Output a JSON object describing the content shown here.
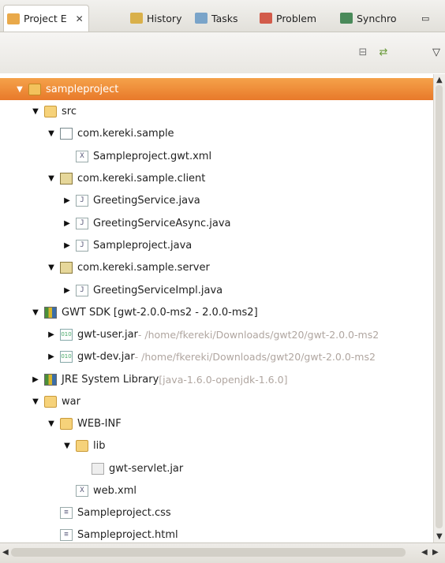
{
  "tabs": [
    {
      "label": "Project E",
      "close": "✕",
      "icon_color": "#e9a94a"
    },
    {
      "label": "History",
      "icon_color": "#d9b04a"
    },
    {
      "label": "Tasks",
      "icon_color": "#7aa4c9"
    },
    {
      "label": "Problem",
      "icon_color": "#d25b4a"
    },
    {
      "label": "Synchro",
      "icon_color": "#4a8a5a"
    }
  ],
  "tree": [
    {
      "label": "sampleproject",
      "extra": "",
      "icon": "project",
      "twisty": "open",
      "selected": true
    },
    {
      "label": "src",
      "extra": "",
      "icon": "folder",
      "twisty": "open"
    },
    {
      "label": "com.kereki.sample",
      "extra": "",
      "icon": "pkgempty",
      "twisty": "open"
    },
    {
      "label": "Sampleproject.gwt.xml",
      "extra": "",
      "icon": "file",
      "glyph": "X",
      "twisty": "none"
    },
    {
      "label": "com.kereki.sample.client",
      "extra": "",
      "icon": "pkg",
      "twisty": "open"
    },
    {
      "label": "GreetingService.java",
      "extra": "",
      "icon": "file",
      "glyph": "J",
      "twisty": "closed"
    },
    {
      "label": "GreetingServiceAsync.java",
      "extra": "",
      "icon": "file",
      "glyph": "J",
      "twisty": "closed"
    },
    {
      "label": "Sampleproject.java",
      "extra": "",
      "icon": "file",
      "glyph": "J",
      "twisty": "closed"
    },
    {
      "label": "com.kereki.sample.server",
      "extra": "",
      "icon": "pkg",
      "twisty": "open"
    },
    {
      "label": "GreetingServiceImpl.java",
      "extra": "",
      "icon": "file",
      "glyph": "J",
      "twisty": "closed"
    },
    {
      "label": "GWT SDK [gwt-2.0.0-ms2 - 2.0.0-ms2]",
      "extra": "",
      "icon": "lib",
      "twisty": "open"
    },
    {
      "label": "gwt-user.jar",
      "extra": " - /home/fkereki/Downloads/gwt20/gwt-2.0.0-ms2",
      "icon": "jar",
      "glyph": "010",
      "twisty": "closed"
    },
    {
      "label": "gwt-dev.jar",
      "extra": " - /home/fkereki/Downloads/gwt20/gwt-2.0.0-ms2",
      "icon": "jar",
      "glyph": "010",
      "twisty": "closed"
    },
    {
      "label": "JRE System Library",
      "extra": " [java-1.6.0-openjdk-1.6.0]",
      "icon": "lib",
      "twisty": "closed"
    },
    {
      "label": "war",
      "extra": "",
      "icon": "folder",
      "twisty": "open"
    },
    {
      "label": "WEB-INF",
      "extra": "",
      "icon": "folder",
      "twisty": "open"
    },
    {
      "label": "lib",
      "extra": "",
      "icon": "folder",
      "twisty": "open"
    },
    {
      "label": "gwt-servlet.jar",
      "extra": "",
      "icon": "jarplain",
      "twisty": "none"
    },
    {
      "label": "web.xml",
      "extra": "",
      "icon": "file",
      "glyph": "X",
      "twisty": "none"
    },
    {
      "label": "Sampleproject.css",
      "extra": "",
      "icon": "file",
      "glyph": "≡",
      "twisty": "none"
    },
    {
      "label": "Sampleproject.html",
      "extra": "",
      "icon": "file",
      "glyph": "≡",
      "twisty": "none"
    }
  ],
  "twisty_glyphs": {
    "open": "▼",
    "closed": "▶",
    "none": ""
  },
  "colors": {
    "selection": "#e8792a"
  }
}
